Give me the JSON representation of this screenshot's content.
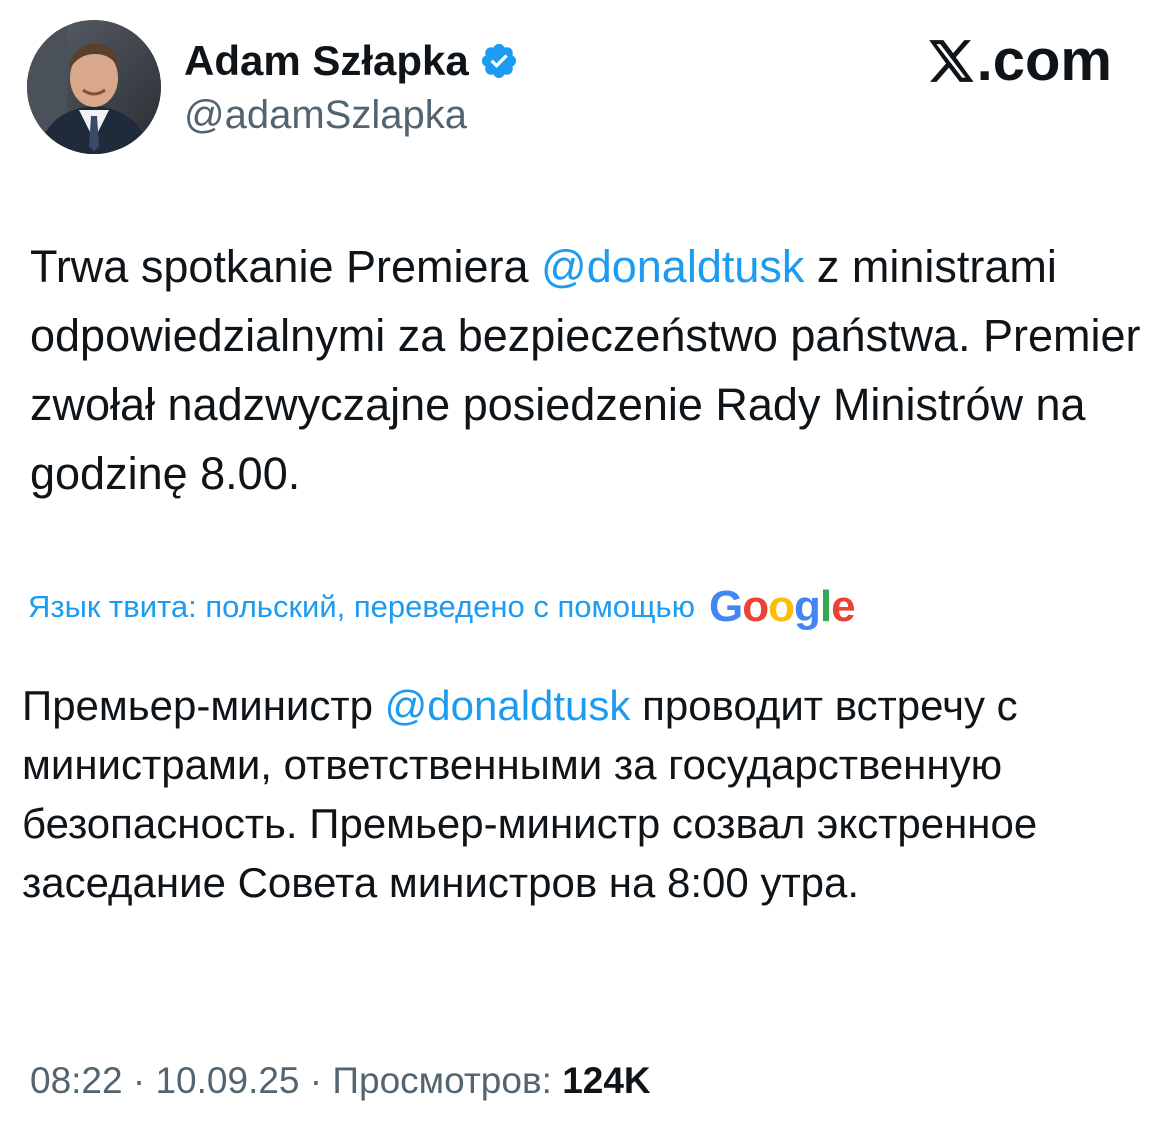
{
  "author": {
    "display_name": "Adam Szłapka",
    "handle": "@adamSzlapka",
    "verified_icon": "verified-badge-icon",
    "avatar_icon": "profile-photo"
  },
  "brand": {
    "label": ".com",
    "logo_icon": "x-logo-icon"
  },
  "tweet": {
    "original": {
      "part1": "Trwa spotkanie Premiera ",
      "mention": "@donaldtusk",
      "part2": " z ministrami odpowiedzialnymi za bezpieczeństwo państwa. Premier zwołał  nadzwyczajne posiedzenie Rady Ministrów na godzinę 8.00."
    },
    "translation_note": "Язык твита: польский, переведено с помощью",
    "translation_provider": {
      "letters": [
        "G",
        "o",
        "o",
        "g",
        "l",
        "e"
      ]
    },
    "translated": {
      "part1": "Премьер-министр ",
      "mention": "@donaldtusk",
      "part2": " проводит встречу с министрами, ответственными за государственную безопасность. Премьер-министр созвал экстренное заседание Совета министров на 8:00 утра."
    }
  },
  "meta": {
    "time": "08:22",
    "separator": " · ",
    "date": "10.09.25",
    "views_label": "Просмотров:",
    "views_count": "124K"
  },
  "colors": {
    "text": "#0f1419",
    "secondary": "#536471",
    "link": "#1d9bf0",
    "google_blue": "#4285f4",
    "google_red": "#ea4335",
    "google_yellow": "#fbbc05",
    "google_green": "#34a853"
  }
}
